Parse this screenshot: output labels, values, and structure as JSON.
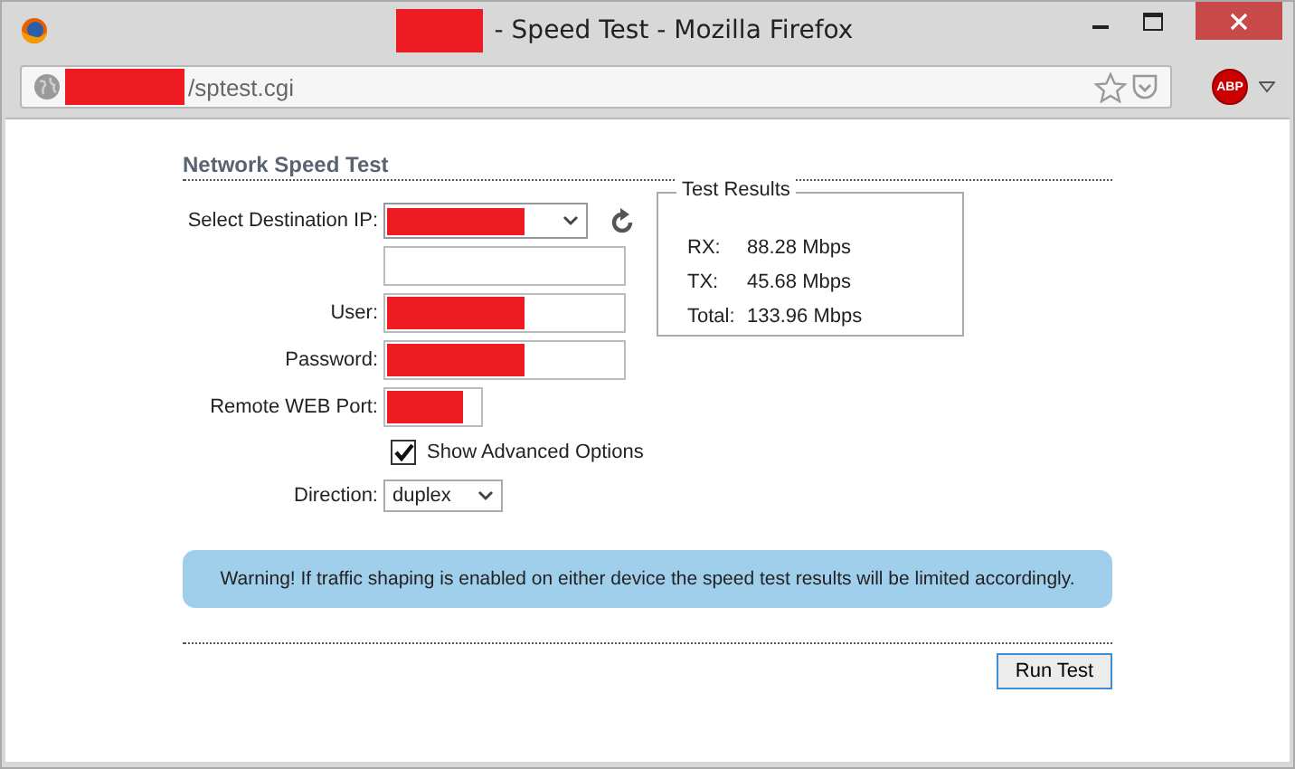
{
  "window": {
    "title_redacted": true,
    "title": "- Speed Test - Mozilla Firefox"
  },
  "address_bar": {
    "url_redacted": true,
    "url": "/sptest.cgi"
  },
  "addon_button": {
    "label": "ABP"
  },
  "page": {
    "heading": "Network Speed Test",
    "fields": [
      {
        "kind": "select",
        "label": "Select Destination IP:",
        "redacted": true
      },
      {
        "kind": "text",
        "redacted": false
      },
      {
        "kind": "text",
        "label": "User:",
        "redacted": true
      },
      {
        "kind": "text",
        "label": "Password:",
        "redacted": true
      },
      {
        "kind": "short",
        "label": "Remote WEB Port:",
        "redacted": true
      },
      {
        "kind": "checkbox",
        "label": "Show Advanced Options",
        "checked": true
      },
      {
        "kind": "dropdown",
        "label": "Direction:",
        "value": "duplex"
      }
    ],
    "results": {
      "title": "Test Results",
      "rows": [
        {
          "label": "RX:",
          "value": "88.28 Mbps"
        },
        {
          "label": "TX:",
          "value": "45.68 Mbps"
        },
        {
          "label": "Total:",
          "value": "133.96 Mbps"
        }
      ]
    },
    "warning": "Warning! If traffic shaping is enabled on either device the speed test results will be limited accordingly.",
    "run_button": "Run Test"
  }
}
